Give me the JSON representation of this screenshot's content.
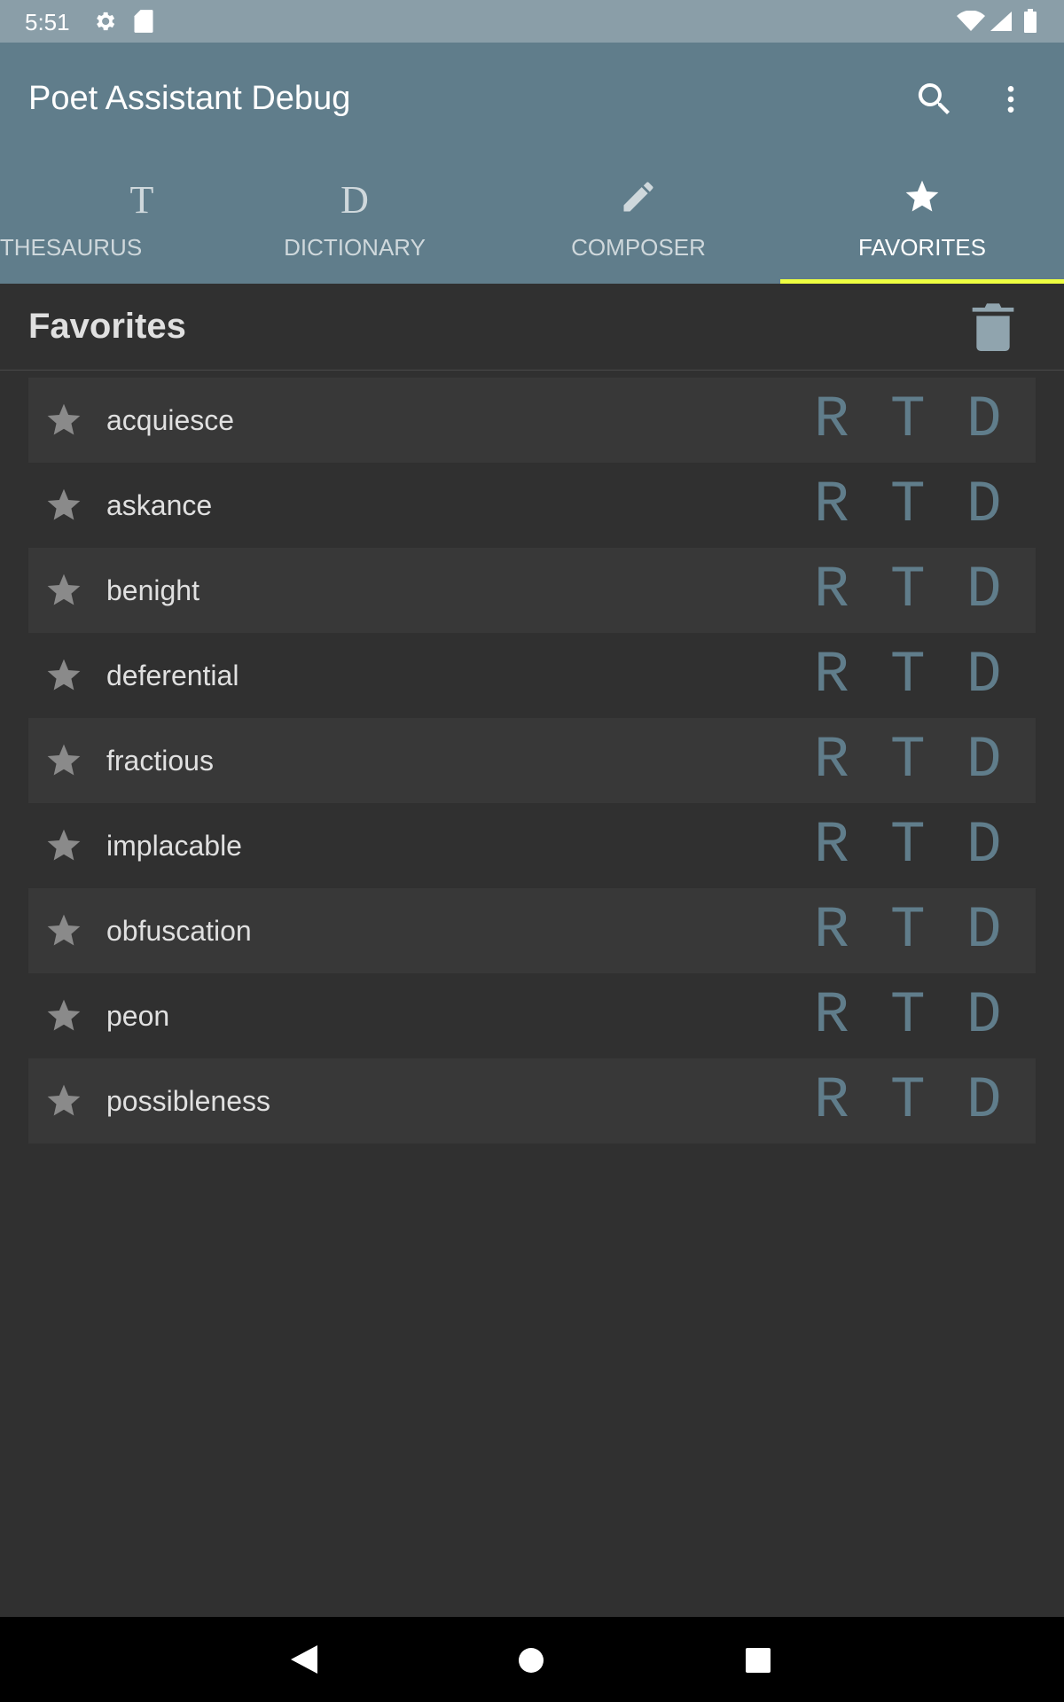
{
  "status_bar": {
    "time": "5:51"
  },
  "app_bar": {
    "title": "Poet Assistant Debug"
  },
  "tabs": [
    {
      "label": "THESAURUS",
      "icon": "T"
    },
    {
      "label": "DICTIONARY",
      "icon": "D"
    },
    {
      "label": "COMPOSER",
      "icon": "pencil-icon"
    },
    {
      "label": "FAVORITES",
      "icon": "star-icon"
    }
  ],
  "active_tab": "FAVORITES",
  "favorites": {
    "title": "Favorites",
    "items": [
      {
        "word": "acquiesce"
      },
      {
        "word": "askance"
      },
      {
        "word": "benight"
      },
      {
        "word": "deferential"
      },
      {
        "word": "fractious"
      },
      {
        "word": "implacable"
      },
      {
        "word": "obfuscation"
      },
      {
        "word": "peon"
      },
      {
        "word": "possibleness"
      }
    ],
    "action_labels": {
      "rhymer": "R",
      "thesaurus": "T",
      "dictionary": "D"
    }
  },
  "colors": {
    "status_bar": "#8a9ea8",
    "primary": "#607d8b",
    "accent_indicator": "#eeff41",
    "background": "#303030"
  }
}
